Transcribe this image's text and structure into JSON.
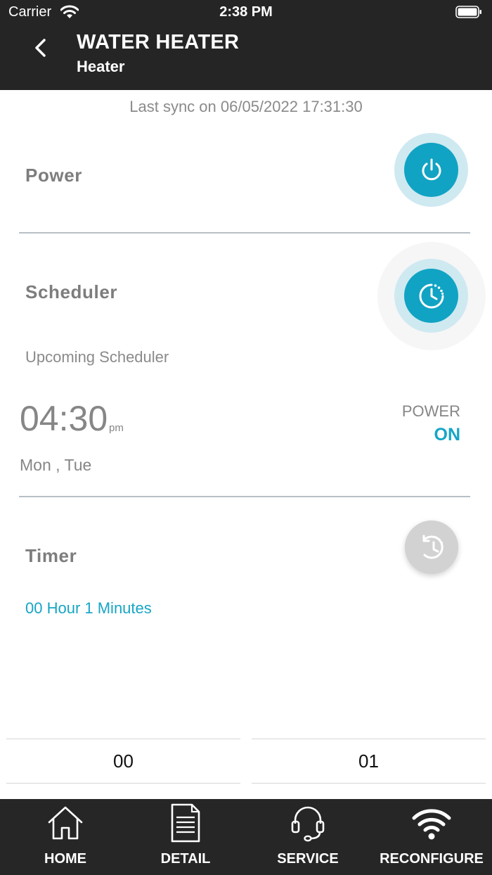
{
  "status_bar": {
    "carrier": "Carrier",
    "time": "2:38 PM"
  },
  "header": {
    "title": "WATER HEATER",
    "subtitle": "Heater"
  },
  "sync": {
    "text": "Last sync on 06/05/2022 17:31:30"
  },
  "power": {
    "label": "Power"
  },
  "scheduler": {
    "label": "Scheduler",
    "upcoming_label": "Upcoming Scheduler",
    "time": "04:30",
    "ampm": "pm",
    "days": "Mon , Tue",
    "action_caption": "POWER",
    "action_state": "ON"
  },
  "timer": {
    "label": "Timer",
    "value": "00 Hour 1 Minutes"
  },
  "picker": {
    "hours": "00",
    "minutes": "01"
  },
  "tabs": [
    {
      "label": "HOME",
      "icon": "home-icon"
    },
    {
      "label": "DETAIL",
      "icon": "document-icon"
    },
    {
      "label": "SERVICE",
      "icon": "headset-icon"
    },
    {
      "label": "RECONFIGURE",
      "icon": "wifi-icon"
    }
  ],
  "colors": {
    "accent": "#11a3c3",
    "header_bg": "#252525",
    "halo": "#cfe9f1"
  }
}
